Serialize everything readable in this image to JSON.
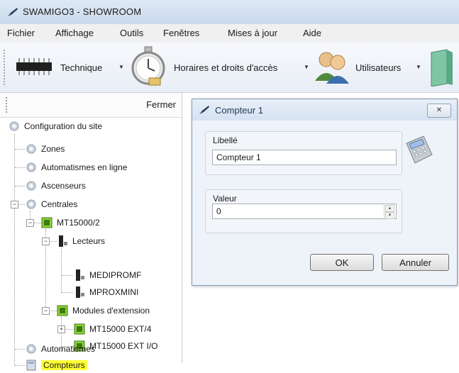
{
  "window": {
    "title": "SWAMIGO3 - SHOWROOM"
  },
  "menu": {
    "items": [
      "Fichier",
      "Affichage",
      "Outils",
      "Fenêtres",
      "Mises à jour",
      "Aide"
    ]
  },
  "toolbar": {
    "technique": "Technique",
    "horaires": "Horaires et droits d'accès",
    "utilisateurs": "Utilisateurs",
    "dropdown_glyph": "▼"
  },
  "left_panel": {
    "close_label": "Fermer",
    "tree": {
      "root": "Configuration du site",
      "zones": "Zones",
      "automatismes_en_ligne": "Automatismes en ligne",
      "ascenseurs": "Ascenseurs",
      "centrales": "Centrales",
      "mt15000": "MT15000/2",
      "lecteurs": "Lecteurs",
      "mediprom": "MEDIPROMF",
      "mproxmini": "MPROXMINI",
      "modules": "Modules d'extension",
      "ext4": "MT15000 EXT/4",
      "extio": "MT15000 EXT I/O",
      "automatismes": "Automatismes",
      "compteurs": "Compteurs"
    }
  },
  "dialog": {
    "title": "Compteur 1",
    "close_glyph": "✕",
    "libelle_label": "Libellé",
    "libelle_value": "Compteur 1",
    "valeur_label": "Valeur",
    "valeur_value": "0",
    "spin_up": "▲",
    "spin_down": "▼",
    "ok_label": "OK",
    "cancel_label": "Annuler"
  },
  "colors": {
    "selection_highlight": "#ffff33",
    "dialog_bg": "#eef3fa",
    "titlebar": "#d6e2f1"
  },
  "icons": [
    "pen-icon",
    "chip-icon",
    "stopwatch-icon",
    "users-icon",
    "book-icon",
    "gear-icon",
    "module-icon",
    "reader-icon",
    "calculator-icon"
  ]
}
